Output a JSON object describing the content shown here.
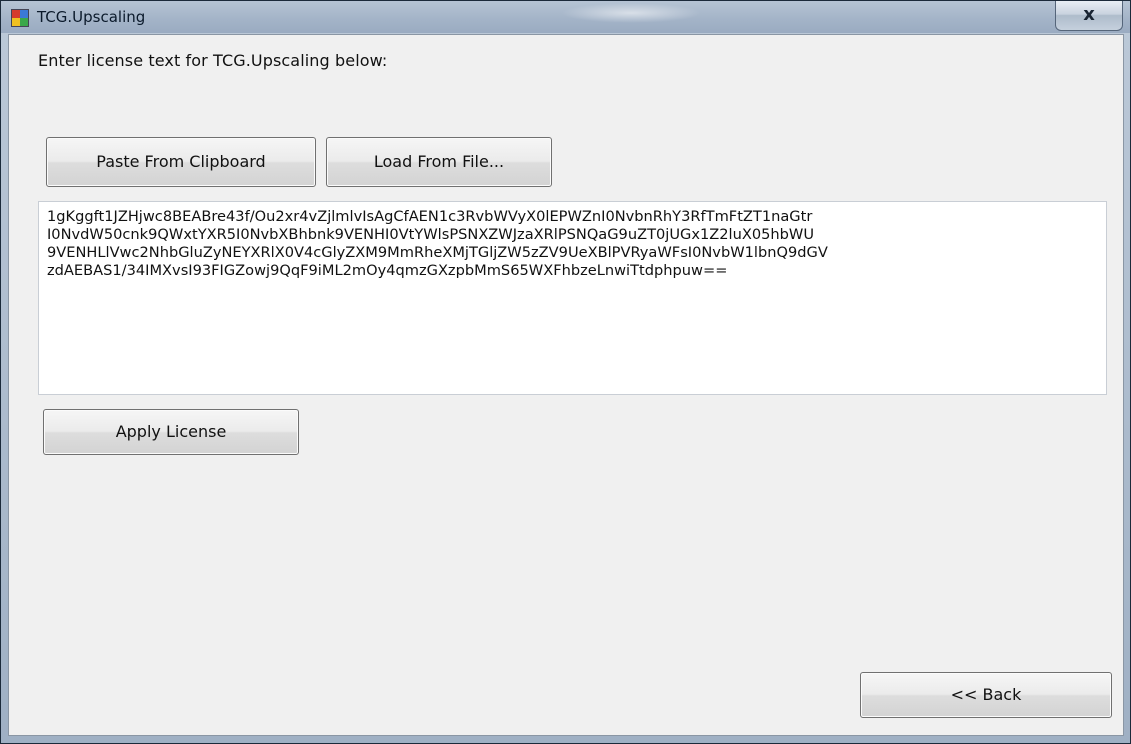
{
  "window": {
    "title": "TCG.Upscaling",
    "close_label": "x"
  },
  "main": {
    "prompt": "Enter license text for TCG.Upscaling below:",
    "paste_label": "Paste From Clipboard",
    "load_label": "Load From File...",
    "license_lines": [
      "1gKggft1JZHjwc8BEABre43f/Ou2xr4vZjlmlvIsAgCfAEN1c3RvbWVyX0lEPWZnI0NvbnRhY3RfTmFtZT1naGtr",
      "I0NvdW50cnk9QWxtYXR5I0NvbXBhbnk9VENHI0VtYWlsPSNXZWJzaXRlPSNQaG9uZT0jUGx1Z2luX05hbWU",
      "9VENHLlVwc2NhbGluZyNEYXRlX0V4cGlyZXM9MmRheXMjTGljZW5zZV9UeXBlPVRyaWFsI0NvbW1lbnQ9dGV",
      "zdAEBAS1/34IMXvsI93FIGZowj9QqF9iML2mOy4qmzGXzpbMmS65WXFhbzeLnwiTtdphpuw=="
    ],
    "apply_label": "Apply License",
    "back_label": "<< Back"
  }
}
